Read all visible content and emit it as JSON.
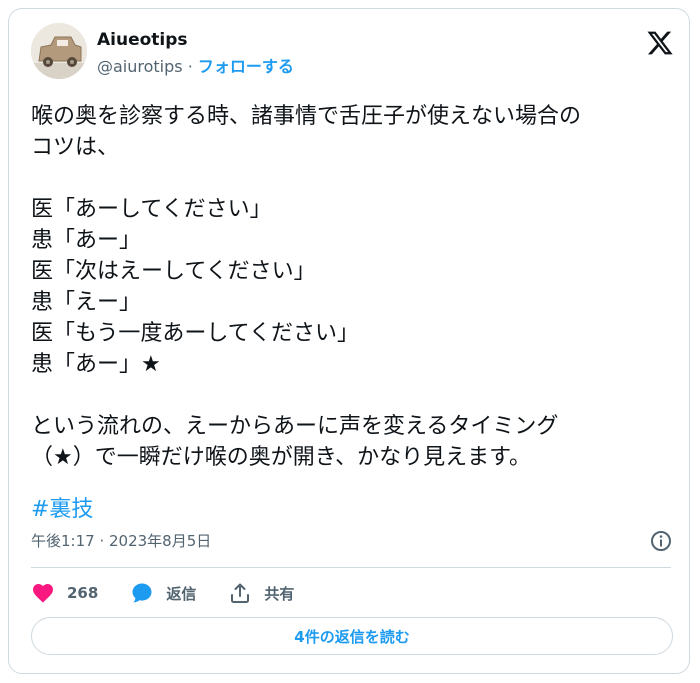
{
  "author": {
    "display_name": "Aiueotips",
    "handle": "@aiurotips",
    "separator": "·",
    "follow_label": "フォローする"
  },
  "tweet": {
    "lines": [
      "喉の奥を診察する時、諸事情で舌圧子が使えない場合の",
      "コツは、",
      "",
      "医「あーしてください」",
      "患「あー」",
      "医「次はえーしてください」",
      "患「えー」",
      "医「もう一度あーしてください」",
      "患「あー」★",
      "",
      "という流れの、えーからあーに声を変えるタイミング",
      "（★）で一瞬だけ喉の奥が開き、かなり見えます。"
    ],
    "hashtag": "#裏技",
    "timestamp": "午後1:17 · 2023年8月5日"
  },
  "actions": {
    "like_count": "268",
    "reply_label": "返信",
    "share_label": "共有"
  },
  "read_replies_label": "4件の返信を読む",
  "colors": {
    "accent": "#1d9bf0",
    "like": "#f91880",
    "muted": "#536471",
    "border": "#cfd9de"
  },
  "icons": [
    "x-logo-icon",
    "info-icon",
    "heart-icon",
    "reply-bubble-icon",
    "share-icon"
  ]
}
